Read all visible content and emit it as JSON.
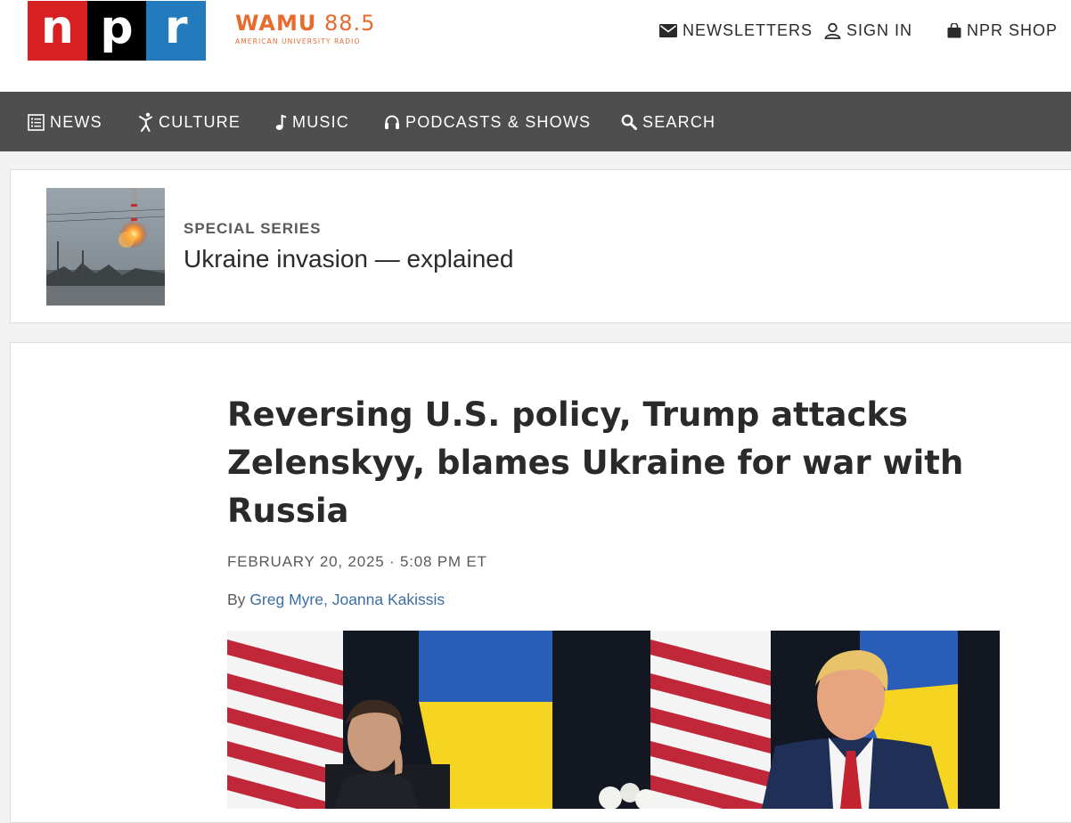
{
  "header": {
    "logo_letters": [
      "n",
      "p",
      "r"
    ],
    "station": {
      "name": "WAMU",
      "frequency": "88.5",
      "subtitle": "AMERICAN UNIVERSITY RADIO"
    },
    "utility_links": {
      "newsletters": "NEWSLETTERS",
      "sign_in": "SIGN IN",
      "shop": "NPR SHOP"
    }
  },
  "nav": {
    "news": "NEWS",
    "culture": "CULTURE",
    "music": "MUSIC",
    "podcasts": "PODCASTS & SHOWS",
    "search": "SEARCH"
  },
  "series": {
    "kicker": "SPECIAL SERIES",
    "title": "Ukraine invasion — explained"
  },
  "article": {
    "headline": "Reversing U.S. policy, Trump attacks Zelenskyy, blames Ukraine for war with Russia",
    "date": "FEBRUARY 20, 2025",
    "separator": "·",
    "time": "5:08 PM ET",
    "byline_prefix": "By",
    "authors": [
      "Greg Myre",
      "Joanna Kakissis"
    ],
    "author_separator": ","
  },
  "colors": {
    "npr_red": "#d62021",
    "npr_black": "#000000",
    "npr_blue": "#237bbd",
    "station_orange": "#e56b2e",
    "nav_bg": "#4e4e4e",
    "link_blue": "#3a6ea5"
  },
  "icons": {
    "newsletters": "envelope-icon",
    "sign_in": "user-icon",
    "shop": "shopping-bag-icon",
    "news": "newspaper-icon",
    "culture": "dancer-icon",
    "music": "music-note-icon",
    "podcasts": "headphones-icon",
    "search": "search-icon"
  }
}
